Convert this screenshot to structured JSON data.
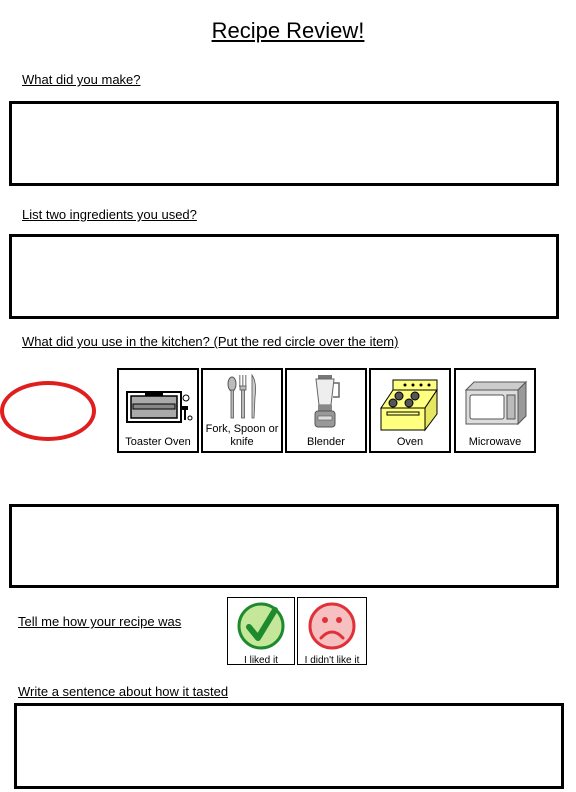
{
  "title": "Recipe Review!",
  "questions": {
    "q1": "What did you make?",
    "q2": "List two ingredients you used?",
    "q3": "What did you use in the kitchen? (Put the red circle over the item)",
    "q4": "Tell me how your recipe was",
    "q5": "Write a sentence about how it tasted"
  },
  "kitchen_items": [
    {
      "label": "Toaster Oven",
      "icon": "toaster-oven-icon"
    },
    {
      "label": "Fork, Spoon or knife",
      "icon": "cutlery-icon"
    },
    {
      "label": "Blender",
      "icon": "blender-icon"
    },
    {
      "label": "Oven",
      "icon": "oven-icon"
    },
    {
      "label": "Microwave",
      "icon": "microwave-icon"
    }
  ],
  "feedback": [
    {
      "label": "I liked it",
      "icon": "check-icon",
      "color": "#1e8a2e",
      "bg": "#c5e79a"
    },
    {
      "label": "I didn't like it",
      "icon": "sad-face-icon",
      "color": "#e0303a",
      "bg": "#f7c0c0"
    }
  ],
  "marker_color": "#e01e1e"
}
